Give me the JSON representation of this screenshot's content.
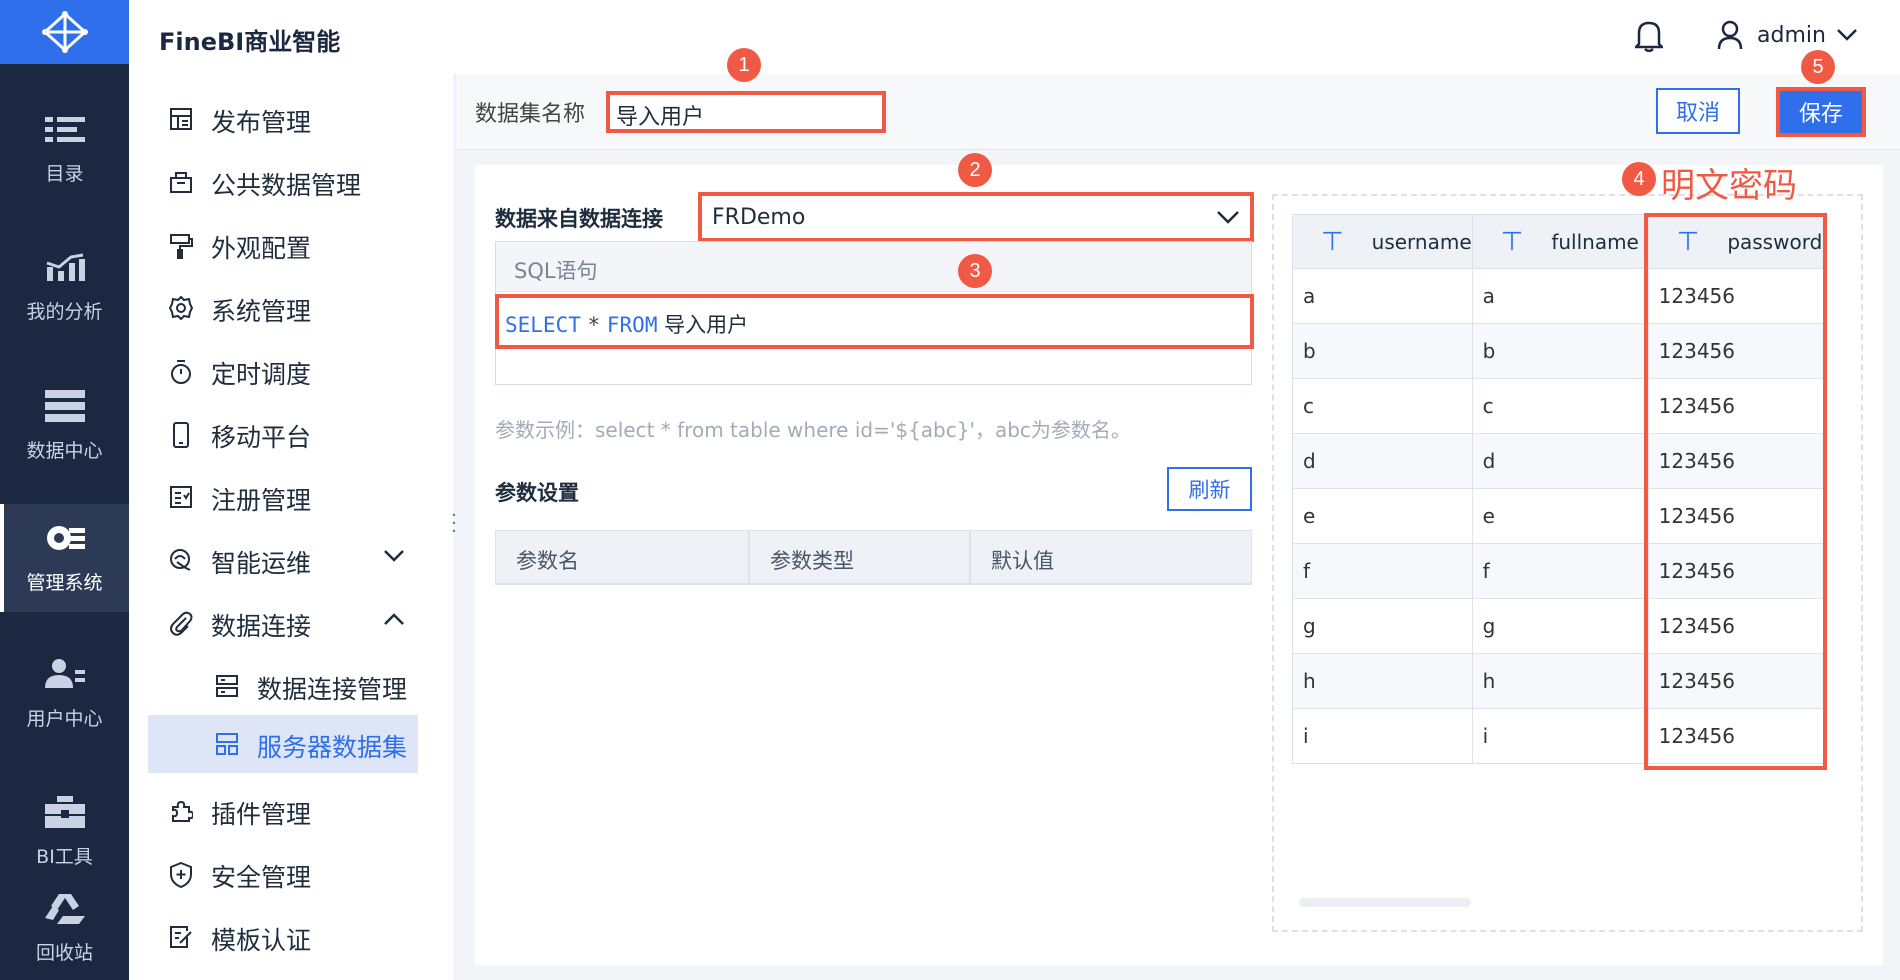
{
  "app": {
    "title": "FineBI商业智能"
  },
  "header": {
    "user": "admin"
  },
  "rail": {
    "items": [
      {
        "label": "目录",
        "icon": "catalog-icon"
      },
      {
        "label": "我的分析",
        "icon": "analysis-icon"
      },
      {
        "label": "数据中心",
        "icon": "data-center-icon"
      },
      {
        "label": "管理系统",
        "icon": "management-icon",
        "active": true
      },
      {
        "label": "用户中心",
        "icon": "user-center-icon"
      },
      {
        "label": "BI工具",
        "icon": "toolbox-icon"
      },
      {
        "label": "回收站",
        "icon": "recycle-icon"
      }
    ]
  },
  "menu": {
    "items": [
      {
        "label": "发布管理",
        "icon": "publish-icon"
      },
      {
        "label": "公共数据管理",
        "icon": "public-data-icon"
      },
      {
        "label": "外观配置",
        "icon": "paint-icon"
      },
      {
        "label": "系统管理",
        "icon": "gear-icon"
      },
      {
        "label": "定时调度",
        "icon": "timer-icon"
      },
      {
        "label": "移动平台",
        "icon": "mobile-icon"
      },
      {
        "label": "注册管理",
        "icon": "register-icon"
      },
      {
        "label": "智能运维",
        "icon": "ops-icon",
        "expandable": true,
        "expanded": false
      },
      {
        "label": "数据连接",
        "icon": "paperclip-icon",
        "expandable": true,
        "expanded": true
      },
      {
        "label": "数据连接管理",
        "icon": "server-icon",
        "sub": true
      },
      {
        "label": "服务器数据集",
        "icon": "dataset-icon",
        "sub": true,
        "selected": true
      },
      {
        "label": "插件管理",
        "icon": "plugin-icon"
      },
      {
        "label": "安全管理",
        "icon": "shield-icon"
      },
      {
        "label": "模板认证",
        "icon": "template-icon"
      }
    ]
  },
  "form": {
    "name_label": "数据集名称",
    "name_value": "导入用户",
    "cancel": "取消",
    "save": "保存",
    "source_label": "数据来自数据连接",
    "source_value": "FRDemo",
    "sql_header": "SQL语句",
    "sql": {
      "kw_select": "SELECT",
      "star": "*",
      "kw_from": "FROM",
      "table": "导入用户"
    },
    "param_hint": "参数示例：select * from table where id='${abc}'，abc为参数名。",
    "param_title": "参数设置",
    "refresh": "刷新",
    "param_columns": [
      "参数名",
      "参数类型",
      "默认值"
    ]
  },
  "preview": {
    "columns": [
      "username",
      "fullname",
      "password"
    ],
    "rows": [
      [
        "a",
        "a",
        "123456"
      ],
      [
        "b",
        "b",
        "123456"
      ],
      [
        "c",
        "c",
        "123456"
      ],
      [
        "d",
        "d",
        "123456"
      ],
      [
        "e",
        "e",
        "123456"
      ],
      [
        "f",
        "f",
        "123456"
      ],
      [
        "g",
        "g",
        "123456"
      ],
      [
        "h",
        "h",
        "123456"
      ],
      [
        "i",
        "i",
        "123456"
      ]
    ]
  },
  "annotations": {
    "badges": [
      "1",
      "2",
      "3",
      "4",
      "5"
    ],
    "plaintext_password": "明文密码"
  },
  "colors": {
    "accent": "#2f6fec",
    "rail": "#1c2841",
    "highlight": "#f05a45"
  }
}
